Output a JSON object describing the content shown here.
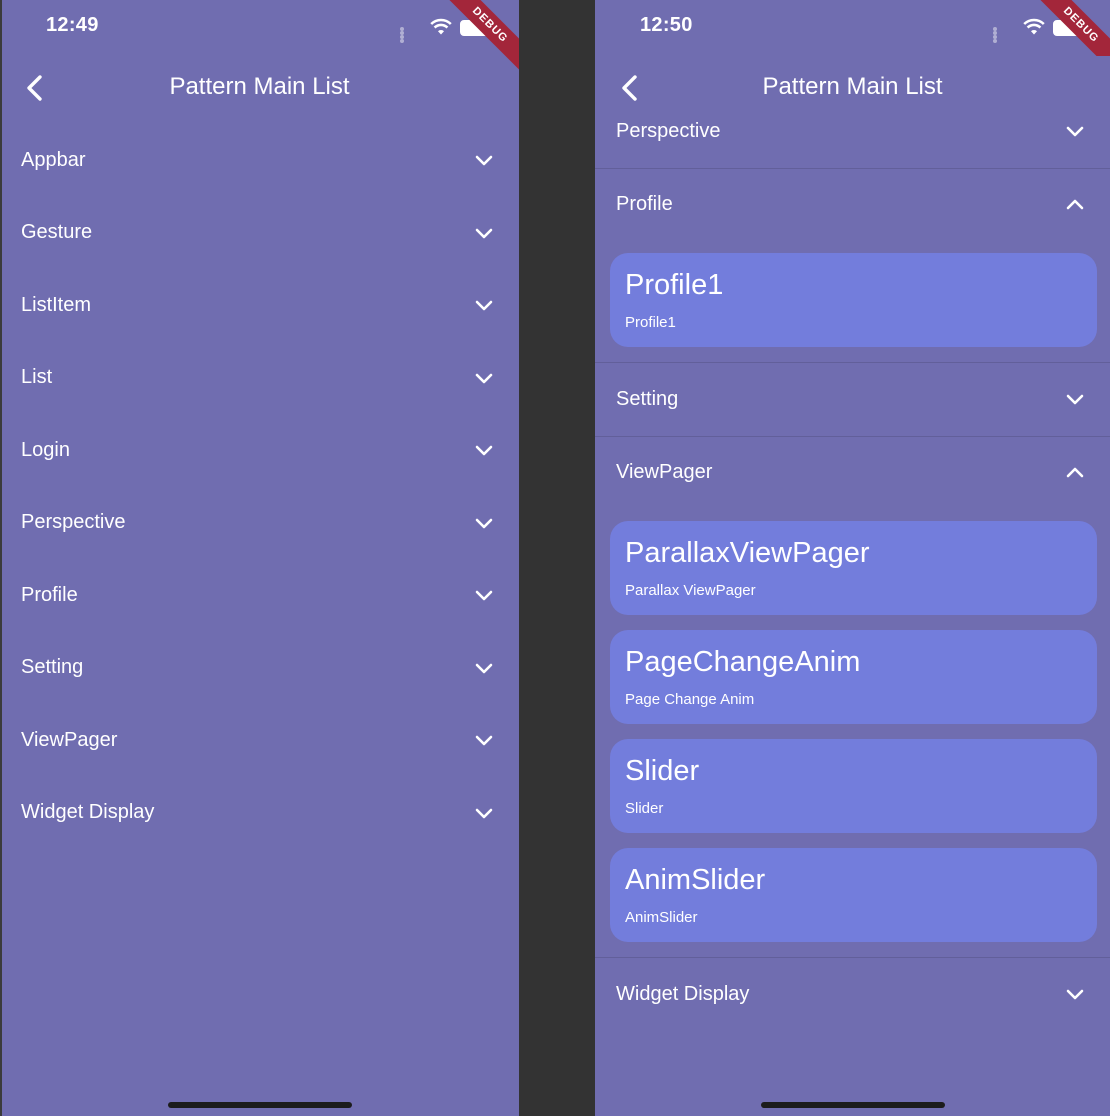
{
  "left": {
    "time": "12:49",
    "title": "Pattern Main List",
    "categories": [
      "Appbar",
      "Gesture",
      "ListItem",
      "List",
      "Login",
      "Perspective",
      "Profile",
      "Setting",
      "ViewPager",
      "Widget Display"
    ]
  },
  "right": {
    "time": "12:50",
    "title": "Pattern Main List",
    "perspective": "Perspective",
    "profile": "Profile",
    "profile_items": [
      {
        "title": "Profile1",
        "subtitle": "Profile1"
      }
    ],
    "setting": "Setting",
    "viewpager": "ViewPager",
    "viewpager_items": [
      {
        "title": "ParallaxViewPager",
        "subtitle": "Parallax ViewPager"
      },
      {
        "title": "PageChangeAnim",
        "subtitle": "Page Change Anim"
      },
      {
        "title": "Slider",
        "subtitle": "Slider"
      },
      {
        "title": "AnimSlider",
        "subtitle": "AnimSlider"
      }
    ],
    "widget_display": "Widget Display"
  },
  "debug_label": "DEBUG",
  "icons": {
    "back": "chevron-left-icon",
    "collapsed": "chevron-down-icon",
    "expanded": "chevron-up-icon",
    "wifi": "wifi-icon",
    "battery": "battery-icon"
  },
  "colors": {
    "background": "#706db0",
    "card": "#737ddc",
    "debug_ribbon": "#a3263a"
  }
}
